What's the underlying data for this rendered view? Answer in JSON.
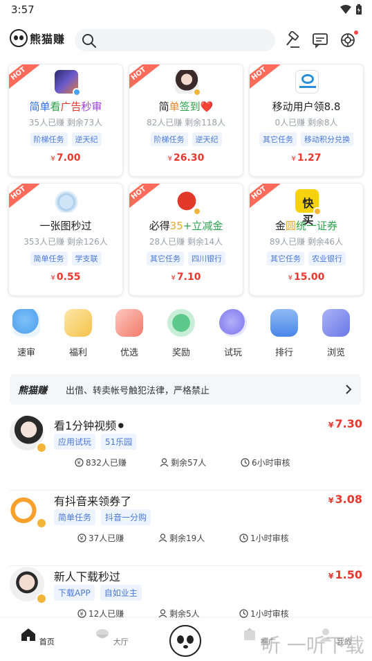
{
  "status_bar": {
    "time": "3:57"
  },
  "header": {
    "logo_text": "熊猫赚"
  },
  "cards": [
    {
      "title": "简单看广告秒审",
      "stats": "35人已赚 剩余73人",
      "tags": [
        "阶梯任务",
        "逆天纪"
      ],
      "price": "7.00",
      "currency": "¥",
      "hot": "HOT",
      "thumb_color": "#6a5acd"
    },
    {
      "title": "简单签到❤️",
      "stats": "82人已赚 剩余118人",
      "tags": [
        "阶梯任务",
        "逆天纪"
      ],
      "price": "26.30",
      "currency": "¥",
      "hot": "HOT",
      "thumb_color": "#d9c7c1"
    },
    {
      "title": "移动用户领8.8",
      "stats": "0人已赚 剩余8人",
      "tags": [
        "其它任务",
        "移动积分兑换"
      ],
      "price": "1.27",
      "currency": "¥",
      "hot": "HOT",
      "thumb_color": "#2b8fd8"
    },
    {
      "title": "一张图秒过",
      "stats": "353人已赚 剩余126人",
      "tags": [
        "简单任务",
        "学支联"
      ],
      "price": "0.55",
      "currency": "¥",
      "hot": "HOT",
      "thumb_color": "#9fc7ea"
    },
    {
      "title": "必得35+立减金",
      "stats": "28人已赚 剩余14人",
      "tags": [
        "其它任务",
        "四川银行"
      ],
      "price": "7.10",
      "currency": "¥",
      "hot": "HOT",
      "thumb_color": "#e23a2a"
    },
    {
      "title": "金圆统一证券",
      "stats": "89人已赚 剩余46人",
      "tags": [
        "其它任务",
        "农业银行"
      ],
      "price": "15.00",
      "currency": "¥",
      "hot": "HOT",
      "thumb_color": "#f5d20c"
    }
  ],
  "nav": [
    {
      "label": "速审",
      "color": "#5aa8f0"
    },
    {
      "label": "福利",
      "color": "#f5c24a"
    },
    {
      "label": "优选",
      "color": "#f47a6a"
    },
    {
      "label": "奖励",
      "color": "#5cc98a"
    },
    {
      "label": "试玩",
      "color": "#8a86f2"
    },
    {
      "label": "排行",
      "color": "#4a86e8"
    },
    {
      "label": "浏览",
      "color": "#6a78e8"
    }
  ],
  "notice": {
    "logo": "熊猫赚",
    "text": "出借、转卖帐号触犯法律，严格禁止"
  },
  "tasks": [
    {
      "title": "看1分钟视频⚫",
      "tags": [
        "应用试玩",
        "51乐园"
      ],
      "price": "7.30",
      "currency": "¥",
      "earned": "832人已赚",
      "remaining": "剩余57人",
      "review": "6小时审核",
      "avatar_color": "#cfcfcf"
    },
    {
      "title": "有抖音来领券了",
      "tags": [
        "简单任务",
        "抖音一分购"
      ],
      "price": "3.08",
      "currency": "¥",
      "earned": "37人已赚",
      "remaining": "剩余19人",
      "review": "1小时审核",
      "avatar_color": "#f7a02c"
    },
    {
      "title": "新人下载秒过",
      "tags": [
        "下载APP",
        "自如业主"
      ],
      "price": "1.50",
      "currency": "¥",
      "earned": "12人已赚",
      "remaining": "剩余5人",
      "review": "1小时审核",
      "avatar_color": "#d8d8d8"
    }
  ],
  "tabbar": [
    {
      "label": "首页",
      "active": true
    },
    {
      "label": "大厅",
      "active": false
    },
    {
      "label": "推广",
      "active": false
    },
    {
      "label": "我的",
      "active": false
    }
  ],
  "watermark": "听 一听下载"
}
